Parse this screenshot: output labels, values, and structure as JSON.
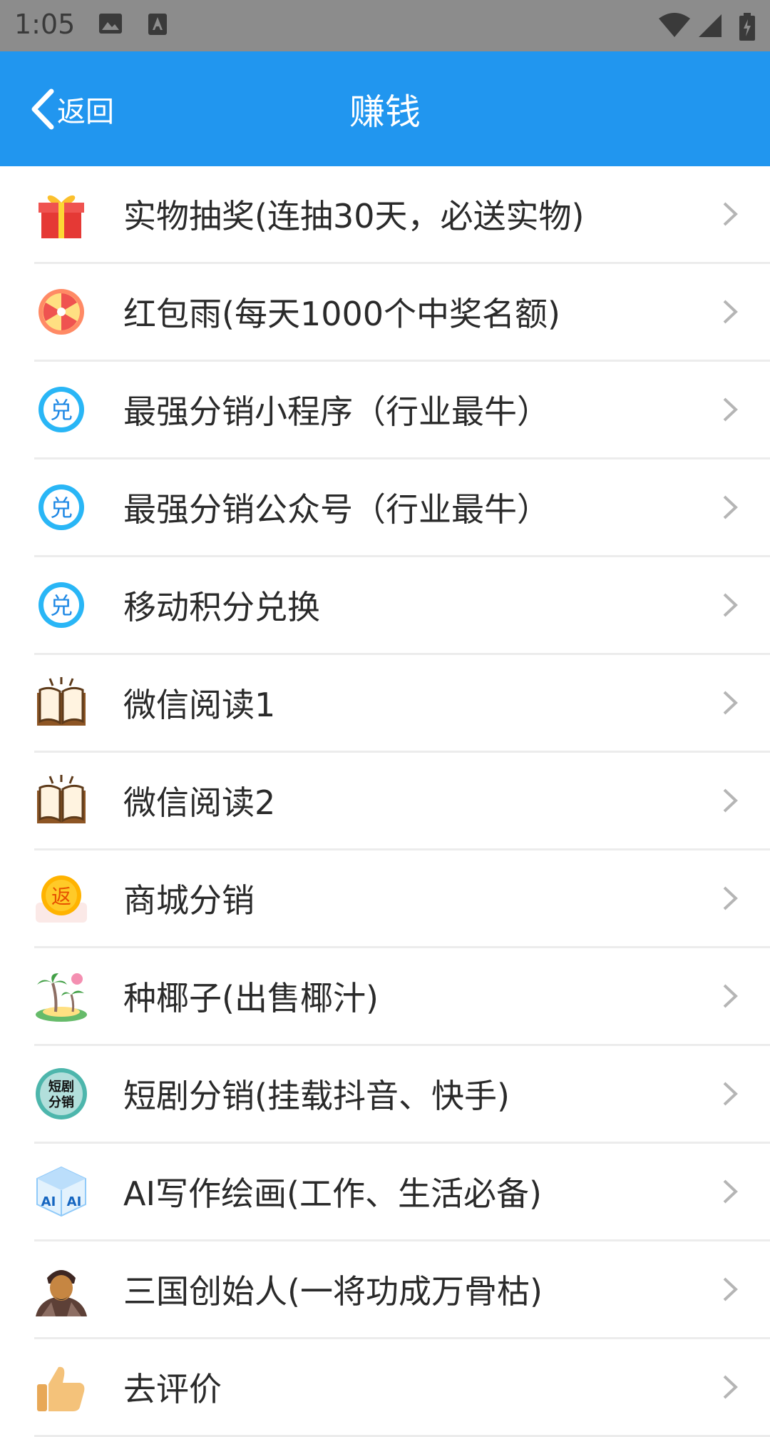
{
  "status_bar": {
    "time": "1:05",
    "icons": [
      "image-icon",
      "text-icon",
      "wifi-icon",
      "signal-icon",
      "battery-icon"
    ]
  },
  "header": {
    "back_label": "返回",
    "title": "赚钱",
    "background": "#2196ef"
  },
  "menu": {
    "items": [
      {
        "label": "实物抽奖(连抽30天，必送实物)",
        "icon": "gift-icon"
      },
      {
        "label": "红包雨(每天1000个中奖名额)",
        "icon": "prize-wheel-icon"
      },
      {
        "label": "最强分销小程序（行业最牛）",
        "icon": "exchange-icon"
      },
      {
        "label": "最强分销公众号（行业最牛）",
        "icon": "exchange-icon"
      },
      {
        "label": "移动积分兑换",
        "icon": "exchange-icon"
      },
      {
        "label": "微信阅读1",
        "icon": "book-icon"
      },
      {
        "label": "微信阅读2",
        "icon": "book-icon"
      },
      {
        "label": "商城分销",
        "icon": "cashback-coin-icon"
      },
      {
        "label": "种椰子(出售椰汁)",
        "icon": "palm-island-icon"
      },
      {
        "label": "短剧分销(挂载抖音、快手)",
        "icon": "short-drama-icon"
      },
      {
        "label": "AI写作绘画(工作、生活必备)",
        "icon": "ai-cube-icon"
      },
      {
        "label": "三国创始人(一将功成万骨枯)",
        "icon": "warrior-avatar-icon"
      },
      {
        "label": "去评价",
        "icon": "thumbs-up-icon"
      }
    ],
    "icon_badge_text": {
      "exchange": "兑",
      "cashback": "返",
      "short_drama_line1": "短剧",
      "short_drama_line2": "分销",
      "ai": "AI"
    }
  }
}
